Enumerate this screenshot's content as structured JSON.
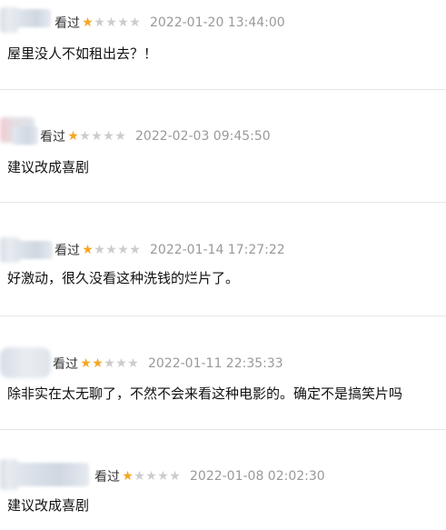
{
  "comments": [
    {
      "seen_label": "看过",
      "rating": 1,
      "max_rating": 5,
      "timestamp": "2022-01-20 13:44:00",
      "text": "屋里没人不如租出去？！"
    },
    {
      "seen_label": "看过",
      "rating": 1,
      "max_rating": 5,
      "timestamp": "2022-02-03 09:45:50",
      "text": "建议改成喜剧"
    },
    {
      "seen_label": "看过",
      "rating": 1,
      "max_rating": 5,
      "timestamp": "2022-01-14 17:27:22",
      "text": "好激动，很久没看这种洗钱的烂片了。"
    },
    {
      "seen_label": "看过",
      "rating": 2,
      "max_rating": 5,
      "timestamp": "2022-01-11 22:35:33",
      "text": "除非实在太无聊了，不然不会来看这种电影的。确定不是搞笑片吗"
    },
    {
      "seen_label": "看过",
      "rating": 1,
      "max_rating": 5,
      "timestamp": "2022-01-08 02:02:30",
      "text": "建议改成喜剧"
    }
  ],
  "colors": {
    "star_on": "#f5a623",
    "star_off": "#cccccc",
    "timestamp": "#999999",
    "divider": "#e6e6e6"
  },
  "icons": {
    "star": "star-icon"
  }
}
